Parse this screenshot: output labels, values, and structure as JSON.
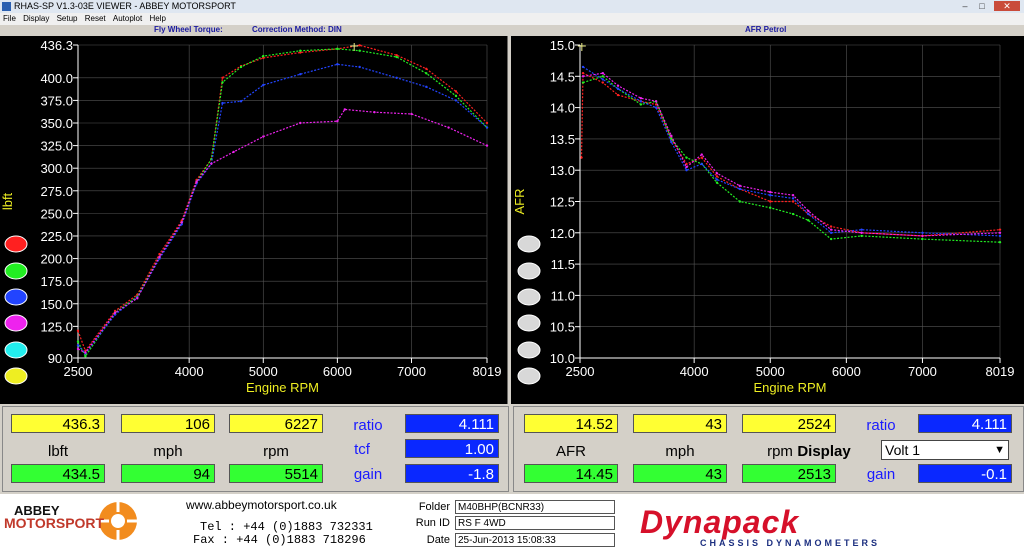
{
  "window": {
    "title": "RHAS-SP V1.3-03E VIEWER - ABBEY MOTORSPORT"
  },
  "menu": [
    "File",
    "Display",
    "Setup",
    "Reset",
    "Autoplot",
    "Help"
  ],
  "left_chart": {
    "title_left": "Fly Wheel Torque:",
    "title_right": "Correction Method: DIN"
  },
  "right_chart": {
    "title": "AFR Petrol"
  },
  "colors": {
    "red": "#ff2020",
    "green": "#22ee22",
    "blue": "#2244ff",
    "magenta": "#ee22ee",
    "cyan": "#22eeee",
    "yellow": "#eeee22"
  },
  "chart_data": [
    {
      "type": "line",
      "title": "",
      "xlabel": "Engine RPM",
      "ylabel": "lbft",
      "xlim": [
        2500,
        8019
      ],
      "ylim": [
        90.0,
        436.3
      ],
      "x_ticks": [
        "2500",
        "4000",
        "5000",
        "6000",
        "7000",
        "8019"
      ],
      "y_ticks": [
        "436.3",
        "400.0",
        "375.0",
        "350.0",
        "325.0",
        "300.0",
        "275.0",
        "250.0",
        "225.0",
        "200.0",
        "175.0",
        "150.0",
        "125.0",
        "90.0"
      ],
      "cursor_x": 6227,
      "series": [
        {
          "color": "#ff2020",
          "points": [
            [
              2500,
              120
            ],
            [
              2600,
              98
            ],
            [
              3000,
              142
            ],
            [
              3300,
              160
            ],
            [
              3600,
              205
            ],
            [
              3900,
              242
            ],
            [
              4100,
              287
            ],
            [
              4300,
              310
            ],
            [
              4450,
              400
            ],
            [
              4700,
              413
            ],
            [
              5000,
              422
            ],
            [
              5500,
              428
            ],
            [
              6000,
              432
            ],
            [
              6300,
              436
            ],
            [
              6800,
              425
            ],
            [
              7200,
              410
            ],
            [
              7600,
              385
            ],
            [
              8019,
              350
            ]
          ]
        },
        {
          "color": "#22ee22",
          "points": [
            [
              2500,
              108
            ],
            [
              2600,
              92
            ],
            [
              3000,
              140
            ],
            [
              3300,
              158
            ],
            [
              3600,
              202
            ],
            [
              3900,
              240
            ],
            [
              4100,
              285
            ],
            [
              4300,
              310
            ],
            [
              4450,
              395
            ],
            [
              4700,
              412
            ],
            [
              5000,
              424
            ],
            [
              5500,
              430
            ],
            [
              6000,
              432
            ],
            [
              6300,
              430
            ],
            [
              6800,
              423
            ],
            [
              7200,
              405
            ],
            [
              7600,
              380
            ],
            [
              8019,
              345
            ]
          ]
        },
        {
          "color": "#2244ff",
          "points": [
            [
              2500,
              104
            ],
            [
              2600,
              95
            ],
            [
              3000,
              138
            ],
            [
              3300,
              157
            ],
            [
              3600,
              200
            ],
            [
              3900,
              238
            ],
            [
              4100,
              283
            ],
            [
              4300,
              305
            ],
            [
              4450,
              372
            ],
            [
              4700,
              374
            ],
            [
              5000,
              392
            ],
            [
              5500,
              404
            ],
            [
              6000,
              415
            ],
            [
              6300,
              412
            ],
            [
              6800,
              400
            ],
            [
              7200,
              390
            ],
            [
              7600,
              375
            ],
            [
              8019,
              345
            ]
          ]
        },
        {
          "color": "#ee22ee",
          "points": [
            [
              2500,
              100
            ],
            [
              2600,
              96
            ],
            [
              3000,
              140
            ],
            [
              3300,
              156
            ],
            [
              3600,
              202
            ],
            [
              3900,
              240
            ],
            [
              4100,
              285
            ],
            [
              4300,
              305
            ],
            [
              4600,
              318
            ],
            [
              5000,
              335
            ],
            [
              5500,
              350
            ],
            [
              6000,
              352
            ],
            [
              6100,
              365
            ],
            [
              6500,
              362
            ],
            [
              7000,
              360
            ],
            [
              7500,
              345
            ],
            [
              8019,
              325
            ]
          ]
        }
      ]
    },
    {
      "type": "line",
      "title": "",
      "xlabel": "Engine RPM",
      "ylabel": "AFR",
      "xlim": [
        2500,
        8019
      ],
      "ylim": [
        10.0,
        15.0
      ],
      "x_ticks": [
        "2500",
        "4000",
        "5000",
        "6000",
        "7000",
        "8019"
      ],
      "y_ticks": [
        "15.0",
        "14.5",
        "14.0",
        "13.5",
        "13.0",
        "12.5",
        "12.0",
        "11.5",
        "11.0",
        "10.5",
        "10.0"
      ],
      "cursor_x": 2524,
      "series": [
        {
          "color": "#ff2020",
          "points": [
            [
              2520,
              13.2
            ],
            [
              2540,
              14.55
            ],
            [
              2800,
              14.4
            ],
            [
              3000,
              14.2
            ],
            [
              3300,
              14.1
            ],
            [
              3500,
              14.05
            ],
            [
              3700,
              13.5
            ],
            [
              3900,
              13.1
            ],
            [
              4100,
              13.2
            ],
            [
              4300,
              12.9
            ],
            [
              4600,
              12.7
            ],
            [
              5000,
              12.5
            ],
            [
              5300,
              12.5
            ],
            [
              5500,
              12.3
            ],
            [
              5800,
              12.1
            ],
            [
              6200,
              12.0
            ],
            [
              7000,
              11.95
            ],
            [
              8019,
              12.05
            ]
          ]
        },
        {
          "color": "#22ee22",
          "points": [
            [
              2540,
              14.4
            ],
            [
              2800,
              14.5
            ],
            [
              3000,
              14.3
            ],
            [
              3300,
              14.05
            ],
            [
              3500,
              14.1
            ],
            [
              3700,
              13.5
            ],
            [
              3900,
              13.2
            ],
            [
              4100,
              13.1
            ],
            [
              4300,
              12.8
            ],
            [
              4600,
              12.5
            ],
            [
              5000,
              12.4
            ],
            [
              5300,
              12.3
            ],
            [
              5500,
              12.2
            ],
            [
              5800,
              11.9
            ],
            [
              6200,
              11.95
            ],
            [
              7000,
              11.9
            ],
            [
              8019,
              11.85
            ]
          ]
        },
        {
          "color": "#2244ff",
          "points": [
            [
              2540,
              14.65
            ],
            [
              2800,
              14.45
            ],
            [
              3000,
              14.3
            ],
            [
              3300,
              14.1
            ],
            [
              3500,
              14.0
            ],
            [
              3700,
              13.45
            ],
            [
              3900,
              13.0
            ],
            [
              4100,
              13.1
            ],
            [
              4300,
              12.85
            ],
            [
              4600,
              12.7
            ],
            [
              5000,
              12.6
            ],
            [
              5300,
              12.55
            ],
            [
              5500,
              12.3
            ],
            [
              5800,
              12.0
            ],
            [
              6200,
              12.05
            ],
            [
              7000,
              12.0
            ],
            [
              8019,
              11.95
            ]
          ]
        },
        {
          "color": "#ee22ee",
          "points": [
            [
              2540,
              14.5
            ],
            [
              2800,
              14.55
            ],
            [
              3000,
              14.35
            ],
            [
              3300,
              14.15
            ],
            [
              3500,
              14.1
            ],
            [
              3700,
              13.55
            ],
            [
              3900,
              13.05
            ],
            [
              4100,
              13.25
            ],
            [
              4300,
              12.95
            ],
            [
              4600,
              12.75
            ],
            [
              5000,
              12.65
            ],
            [
              5300,
              12.6
            ],
            [
              5500,
              12.35
            ],
            [
              5800,
              12.05
            ],
            [
              6200,
              12.0
            ],
            [
              7000,
              11.95
            ],
            [
              8019,
              12.0
            ]
          ]
        }
      ]
    }
  ],
  "left_panel": {
    "top_values": [
      "436.3",
      "106",
      "6227"
    ],
    "labels": [
      "lbft",
      "mph",
      "rpm"
    ],
    "bottom_values": [
      "434.5",
      "94",
      "5514"
    ],
    "ratio_label": "ratio",
    "ratio_value": "4.111",
    "tcf_label": "tcf",
    "tcf_value": "1.00",
    "gain_label": "gain",
    "gain_value": "-1.8"
  },
  "right_panel": {
    "top_values": [
      "14.52",
      "43",
      "2524"
    ],
    "labels": [
      "AFR",
      "mph",
      "rpm"
    ],
    "bottom_values": [
      "14.45",
      "43",
      "2513"
    ],
    "ratio_label": "ratio",
    "ratio_value": "4.111",
    "display_label": "Display",
    "display_value": "Volt 1",
    "gain_label": "gain",
    "gain_value": "-0.1"
  },
  "footer": {
    "logo_line1": "ABBEY",
    "logo_line2": "MOTORSPORT",
    "website": "www.abbeymotorsport.co.uk",
    "tel": "Tel : +44 (0)1883 732331",
    "fax": "Fax : +44 (0)1883 718296",
    "folder_label": "Folder",
    "folder_value": "M40BHP(BCNR33)",
    "runid_label": "Run ID",
    "runid_value": "RS F 4WD",
    "date_label": "Date",
    "date_value": "25-Jun-2013  15:08:33",
    "brand": "Dynapack",
    "brand_sub": "CHASSIS DYNAMOMETERS"
  }
}
